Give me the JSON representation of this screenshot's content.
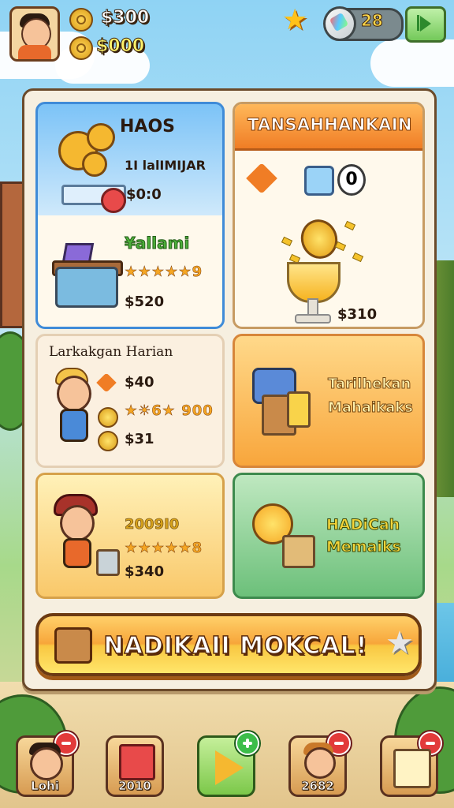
{
  "top_bar": {
    "coins": "$300",
    "gold": "$000",
    "gems": "28"
  },
  "cards": {
    "heroes": {
      "title": "HAOS",
      "subtitle": "1I lalIMIJAR",
      "price_top": "$0:0",
      "item_name": "¥allami",
      "stars": "★★★★★9",
      "price_bottom": "$520"
    },
    "daily": {
      "title": "TANSAHHANKAIN",
      "counter": "0",
      "price": "$310"
    },
    "task": {
      "title": "Larkakgan Harian",
      "price_1": "$40",
      "stars": "★☀6★ 900",
      "price_2": "$31"
    },
    "special": {
      "line1": "Tarilhekan",
      "line2": "Mahaikaks"
    },
    "pack": {
      "code": "2009I0",
      "stars": "★★★★★8",
      "price": "$340"
    },
    "gift": {
      "line1": "HADiCah",
      "line2": "Memaiks"
    }
  },
  "main_button": {
    "label": "NADIKAII MOKCAL!"
  },
  "bottom_nav": [
    {
      "label": "Lohi",
      "icon": "profile-icon"
    },
    {
      "label": "2010",
      "icon": "map-bag-icon"
    },
    {
      "label": "",
      "icon": "play-arrow-icon"
    },
    {
      "label": "2682",
      "icon": "friend-icon"
    },
    {
      "label": "",
      "icon": "scroll-icon"
    }
  ],
  "colors": {
    "accent_orange": "#f07d25",
    "accent_blue": "#3f8bd8",
    "accent_green": "#3d8a4d",
    "gold": "#f5b830"
  }
}
